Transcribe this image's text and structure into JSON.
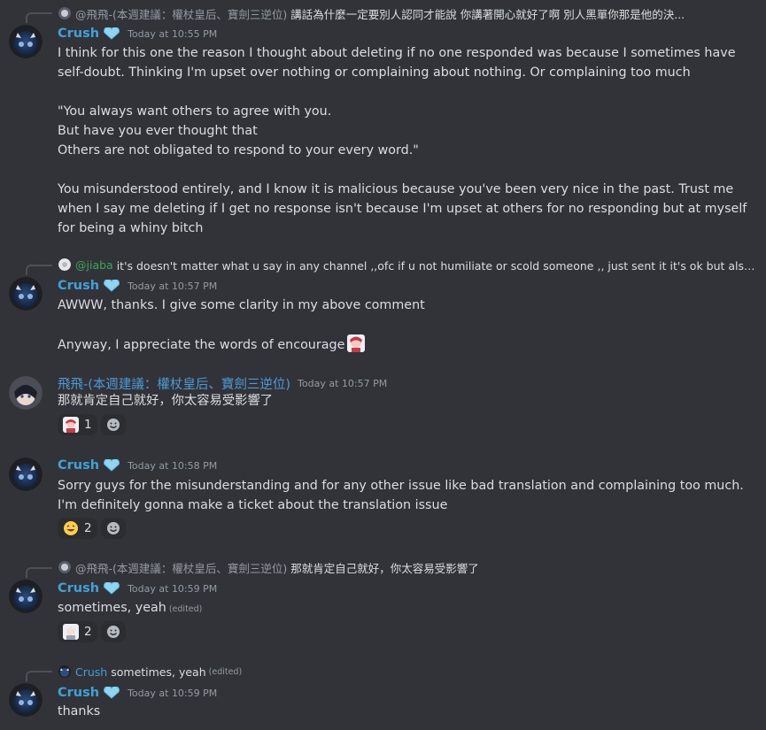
{
  "messages": [
    {
      "reply": {
        "mention": "@飛飛-(本週建議：權杖皇后、寶劍三逆位)",
        "text": "講話為什麼一定要別人認同才能說 你講著開心就好了啊 別人黑單你那是他的決..."
      },
      "author": "Crush",
      "time": "Today at 10:55 PM",
      "body": [
        "I think for this one the reason I thought about deleting if no one responded was because I sometimes have self-doubt. Thinking I'm upset over nothing or complaining about nothing. Or complaining too much",
        "",
        "\"You always want others to agree with you.",
        "But have you ever thought that",
        "Others are not obligated to respond to your every word.\"",
        "",
        "You misunderstood entirely, and I know it is malicious because you've been very nice in the past. Trust me when I say me deleting if I get no response isn't because I'm upset at others for no responding but at myself for being a whiny bitch"
      ]
    },
    {
      "reply": {
        "mention": "@jiaba",
        "text": "it's doesn't matter what u say in any channel ,,ofc if u not humiliate or scold someone ,, just sent it it's ok  but also like飛..."
      },
      "author": "Crush",
      "time": "Today at 10:57 PM",
      "body": [
        "AWWW, thanks. I give some clarity in my above comment",
        "",
        "Anyway, I appreciate the words of encourage"
      ]
    },
    {
      "author": "飛飛-(本週建議：權杖皇后、寶劍三逆位)",
      "time": "Today at 10:57 PM",
      "body": [
        "那就肯定自己就好，你太容易受影響了"
      ],
      "reactions": [
        {
          "emoji": "anime-emoji",
          "count": "1"
        }
      ]
    },
    {
      "author": "Crush",
      "time": "Today at 10:58 PM",
      "body": [
        "Sorry guys for the misunderstanding and for any other issue like bad translation and complaining too much. I'm definitely gonna make a ticket about the translation issue"
      ],
      "reactions": [
        {
          "emoji": "grin-emoji",
          "count": "2"
        }
      ]
    },
    {
      "reply": {
        "mention": "@飛飛-(本週建議：權杖皇后、寶劍三逆位)",
        "text": "那就肯定自己就好，你太容易受影響了"
      },
      "author": "Crush",
      "time": "Today at 10:59 PM",
      "body": [
        "sometimes, yeah"
      ],
      "edited": "(edited)",
      "reactions": [
        {
          "emoji": "anime-emoji",
          "count": "2"
        }
      ]
    },
    {
      "reply": {
        "mention": "Crush",
        "text": "sometimes, yeah",
        "edited": "(edited)"
      },
      "author": "Crush",
      "time": "Today at 10:59 PM",
      "body": [
        "thanks"
      ]
    }
  ],
  "colors": {
    "background": "#313338",
    "username": "#3fa2d9",
    "text": "#dbdee1",
    "muted": "#949ba4",
    "jiaba": "#3ba55d"
  }
}
